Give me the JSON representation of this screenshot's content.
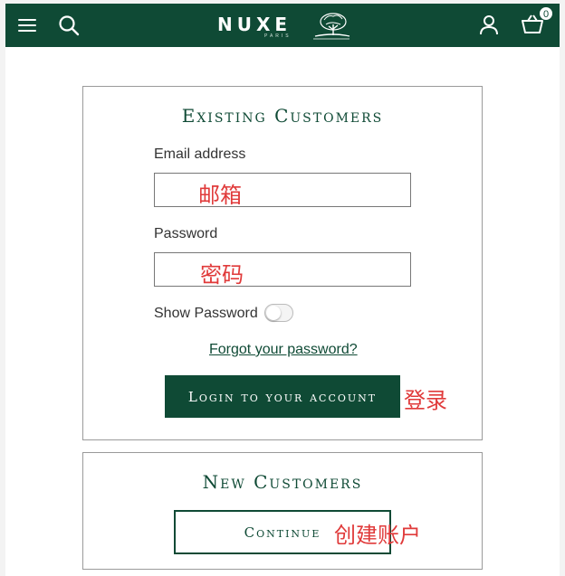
{
  "header": {
    "brand": "NUXE",
    "brand_sub": "PARIS",
    "basket_count": "0",
    "background_color": "#0f4a35",
    "icons": [
      "menu-icon",
      "search-icon",
      "logo-tree-icon",
      "account-icon",
      "basket-icon"
    ]
  },
  "existing": {
    "title": "Existing Customers",
    "email_label": "Email address",
    "email_value": "",
    "email_annotation": "邮箱",
    "password_label": "Password",
    "password_value": "",
    "password_annotation": "密码",
    "show_password_label": "Show Password",
    "show_password_on": false,
    "forgot_link": "Forgot your password?",
    "login_button": "Login to your account",
    "login_annotation": "登录"
  },
  "new_customers": {
    "title": "New Customers",
    "continue_button": "Continue",
    "continue_annotation": "创建账户"
  },
  "colors": {
    "brand_green": "#0f4a35",
    "annotation_red": "#e03a3a"
  }
}
